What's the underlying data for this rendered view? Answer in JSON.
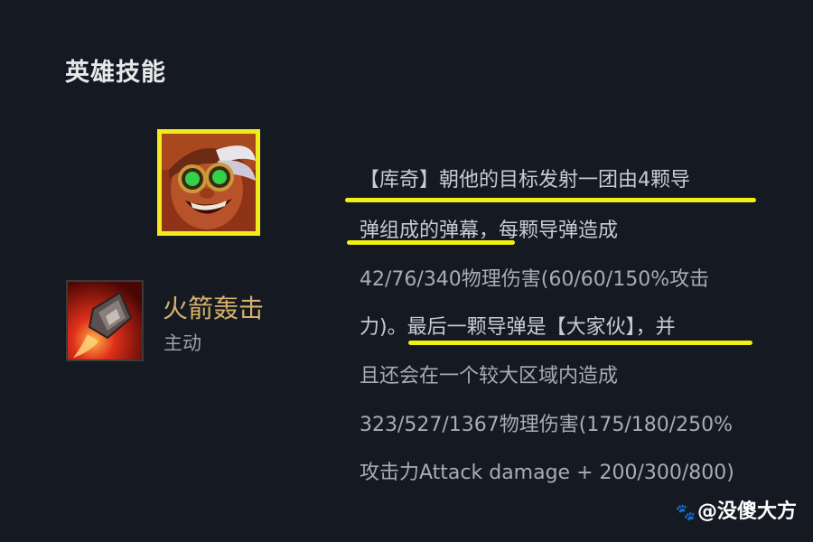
{
  "section": {
    "title": "英雄技能"
  },
  "skill": {
    "name": "火箭轰击",
    "type": "主动"
  },
  "description": {
    "lines": [
      "【库奇】朝他的目标发射一团由4颗导",
      "弹组成的弹幕，每颗导弹造成",
      "42/76/340物理伤害(60/60/150%攻击",
      "力)。最后一颗导弹是【大家伙】，并",
      "且还会在一个较大区域内造成",
      "323/527/1367物理伤害(175/180/250%",
      "攻击力Attack damage + 200/300/800)"
    ]
  },
  "watermark": {
    "text": "@没傻大方"
  },
  "colors": {
    "background": "#141922",
    "highlight_underline": "#f4ef12",
    "portrait_border": "#f2ea1a",
    "skill_name": "#d7b06b"
  },
  "icons": {
    "portrait": "champion-portrait-icon",
    "skill": "rocket-barrage-icon",
    "watermark": "paw-icon"
  }
}
